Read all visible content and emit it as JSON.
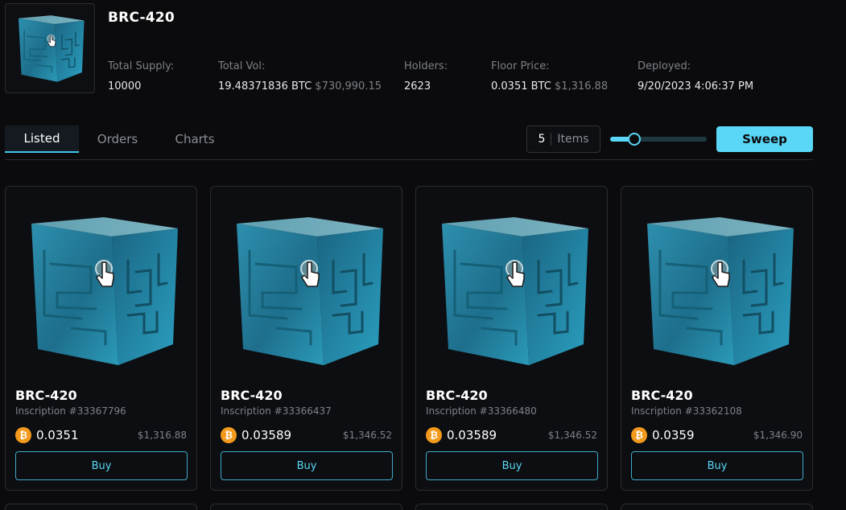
{
  "collection": {
    "name": "BRC-420",
    "stats": [
      {
        "label": "Total Supply:",
        "value": "10000",
        "usd": ""
      },
      {
        "label": "Total Vol:",
        "value": "19.48371836 BTC",
        "usd": "$730,990.15"
      },
      {
        "label": "Holders:",
        "value": "2623",
        "usd": ""
      },
      {
        "label": "Floor Price:",
        "value": "0.0351 BTC",
        "usd": "$1,316.88"
      },
      {
        "label": "Deployed:",
        "value": "9/20/2023 4:06:37 PM",
        "usd": ""
      }
    ]
  },
  "tabs": [
    {
      "label": "Listed",
      "active": true
    },
    {
      "label": "Orders",
      "active": false
    },
    {
      "label": "Charts",
      "active": false
    }
  ],
  "sweep": {
    "count": "5",
    "unit": "Items",
    "slider_fraction": 0.25,
    "button_label": "Sweep"
  },
  "cards": [
    {
      "name": "BRC-420",
      "inscription": "Inscription #33367796",
      "price": "0.0351",
      "usd": "$1,316.88",
      "buy_label": "Buy"
    },
    {
      "name": "BRC-420",
      "inscription": "Inscription #33366437",
      "price": "0.03589",
      "usd": "$1,346.52",
      "buy_label": "Buy"
    },
    {
      "name": "BRC-420",
      "inscription": "Inscription #33366480",
      "price": "0.03589",
      "usd": "$1,346.52",
      "buy_label": "Buy"
    },
    {
      "name": "BRC-420",
      "inscription": "Inscription #33362108",
      "price": "0.0359",
      "usd": "$1,346.90",
      "buy_label": "Buy"
    }
  ],
  "icons": {
    "btc": "bitcoin-icon",
    "btc_glyph": "₿",
    "art": "brc420-cube-icon"
  },
  "colors": {
    "accent": "#5ad7f7",
    "btc": "#f39a1d",
    "background": "#0b0b0d"
  }
}
